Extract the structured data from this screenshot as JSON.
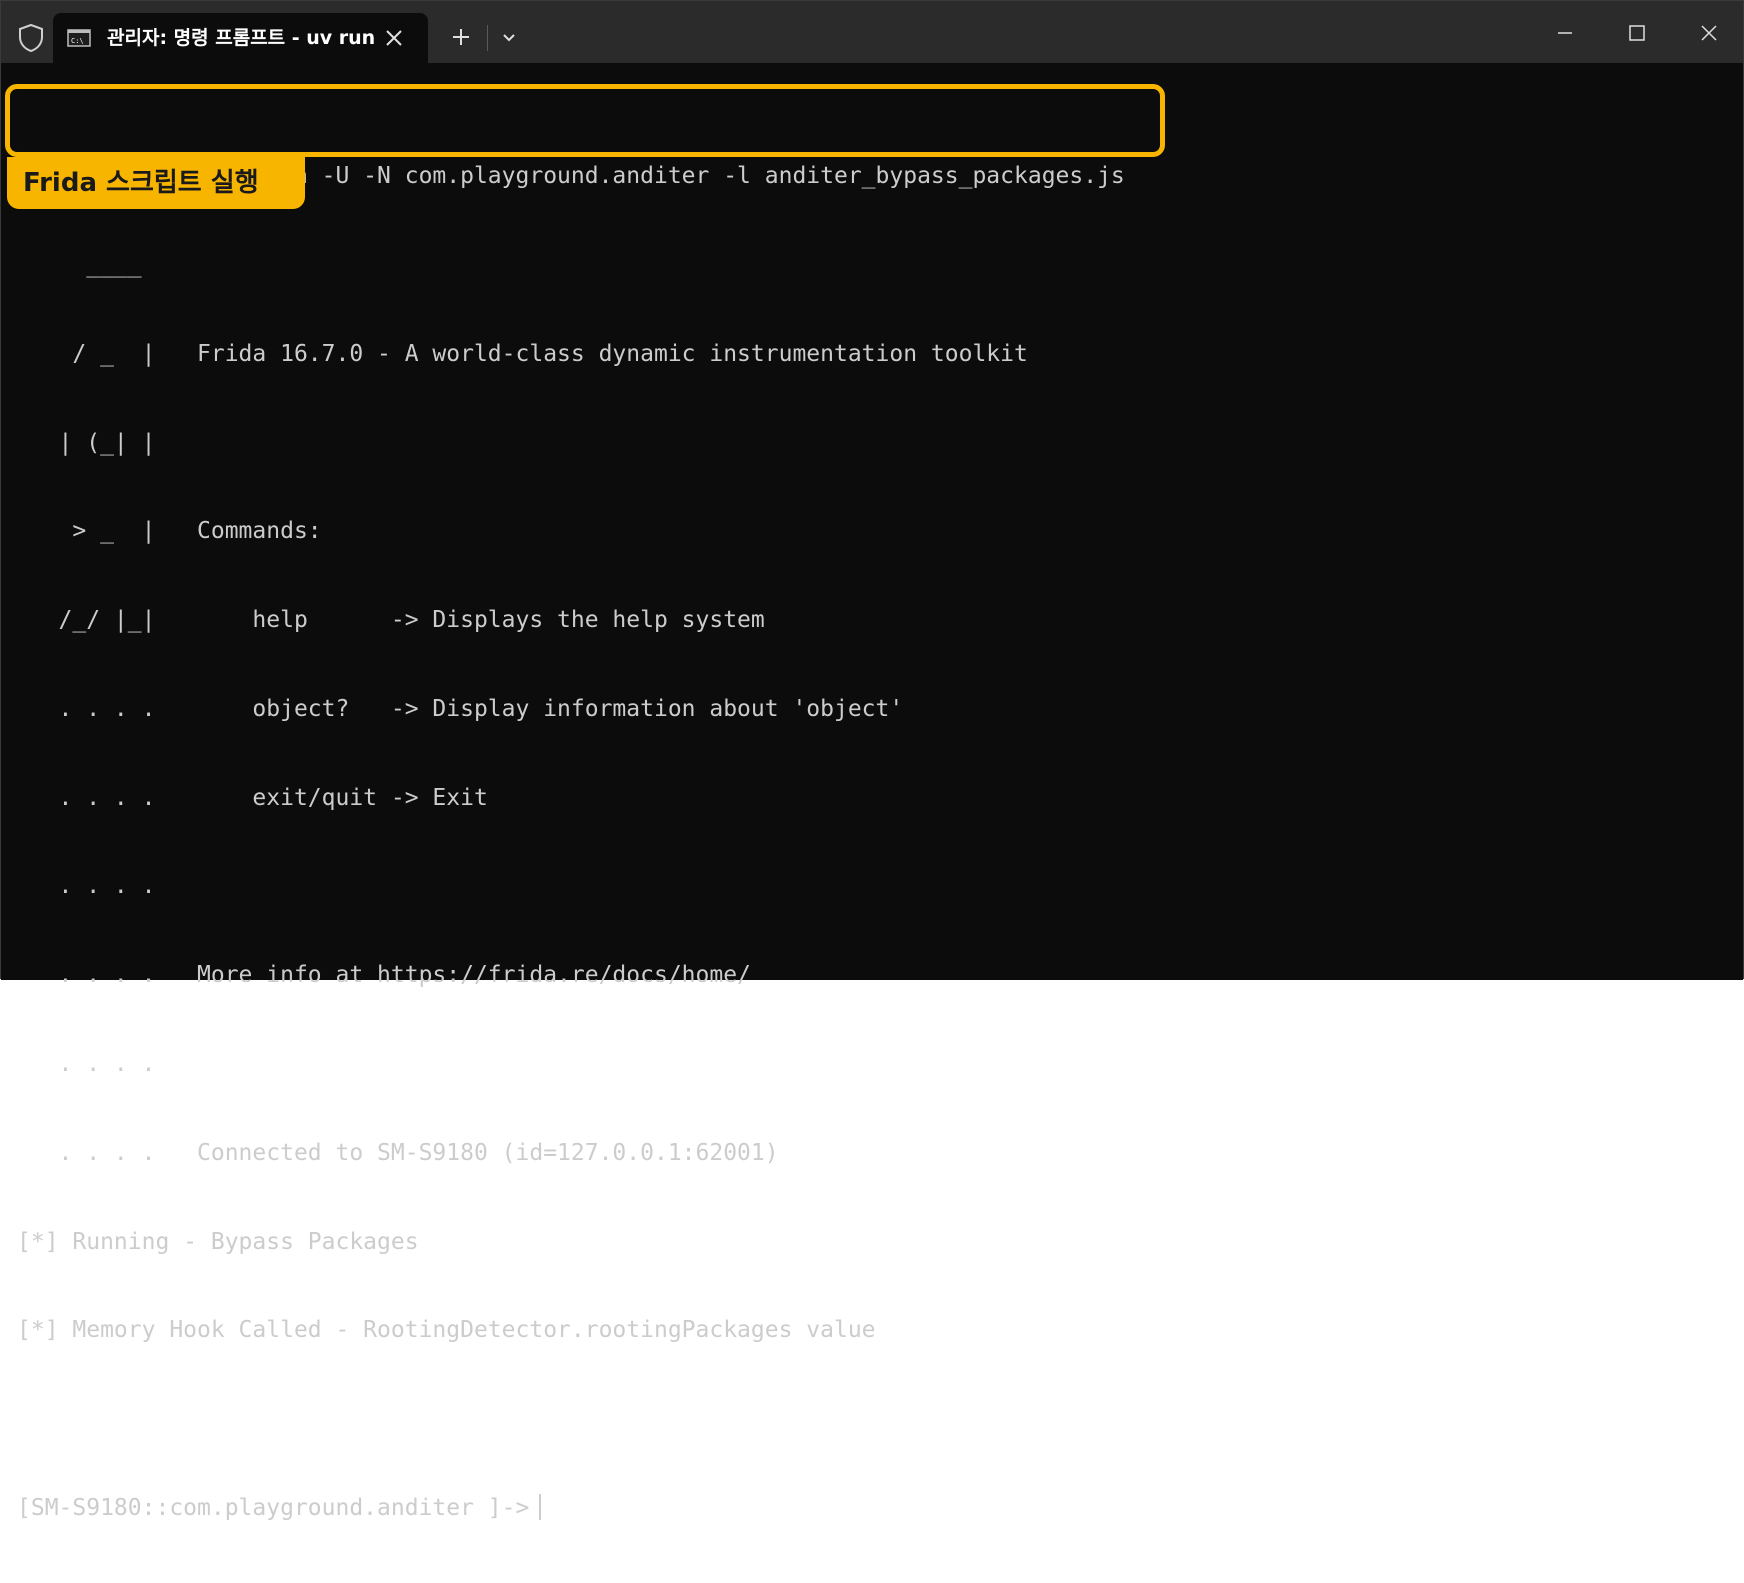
{
  "window": {
    "tab_title": "관리자: 명령 프롬프트 - uv  run",
    "icons": {
      "shield": "shield-icon",
      "tab": "command-prompt-icon",
      "close_tab": "close-icon",
      "new_tab": "plus-icon",
      "dropdown": "chevron-down-icon",
      "minimize": "minimize-icon",
      "maximize": "maximize-icon",
      "close_window": "close-icon"
    }
  },
  "terminal": {
    "lines": [
      "D:\\frida>uv run frida -U -N com.playground.anditer -l anditer_bypass_packages.js",
      "     ____",
      "    / _  |   Frida 16.7.0 - A world-class dynamic instrumentation toolkit",
      "   | (_| |",
      "    > _  |   Commands:",
      "   /_/ |_|       help      -> Displays the help system",
      "   . . . .       object?   -> Display information about 'object'",
      "   . . . .       exit/quit -> Exit",
      "   . . . .",
      "   . . . .   More info at https://frida.re/docs/home/",
      "   . . . .",
      "   . . . .   Connected to SM-S9180 (id=127.0.0.1:62001)",
      "[*] Running - Bypass Packages",
      "[*] Memory Hook Called - RootingDetector.rootingPackages value",
      "",
      "[SM-S9180::com.playground.anditer ]->"
    ]
  },
  "annotation": {
    "label": "Frida 스크립트 실행",
    "color": "#f7b500"
  },
  "colors": {
    "background": "#0c0c0c",
    "titlebar": "#2b2b2b",
    "text": "#cccccc"
  }
}
